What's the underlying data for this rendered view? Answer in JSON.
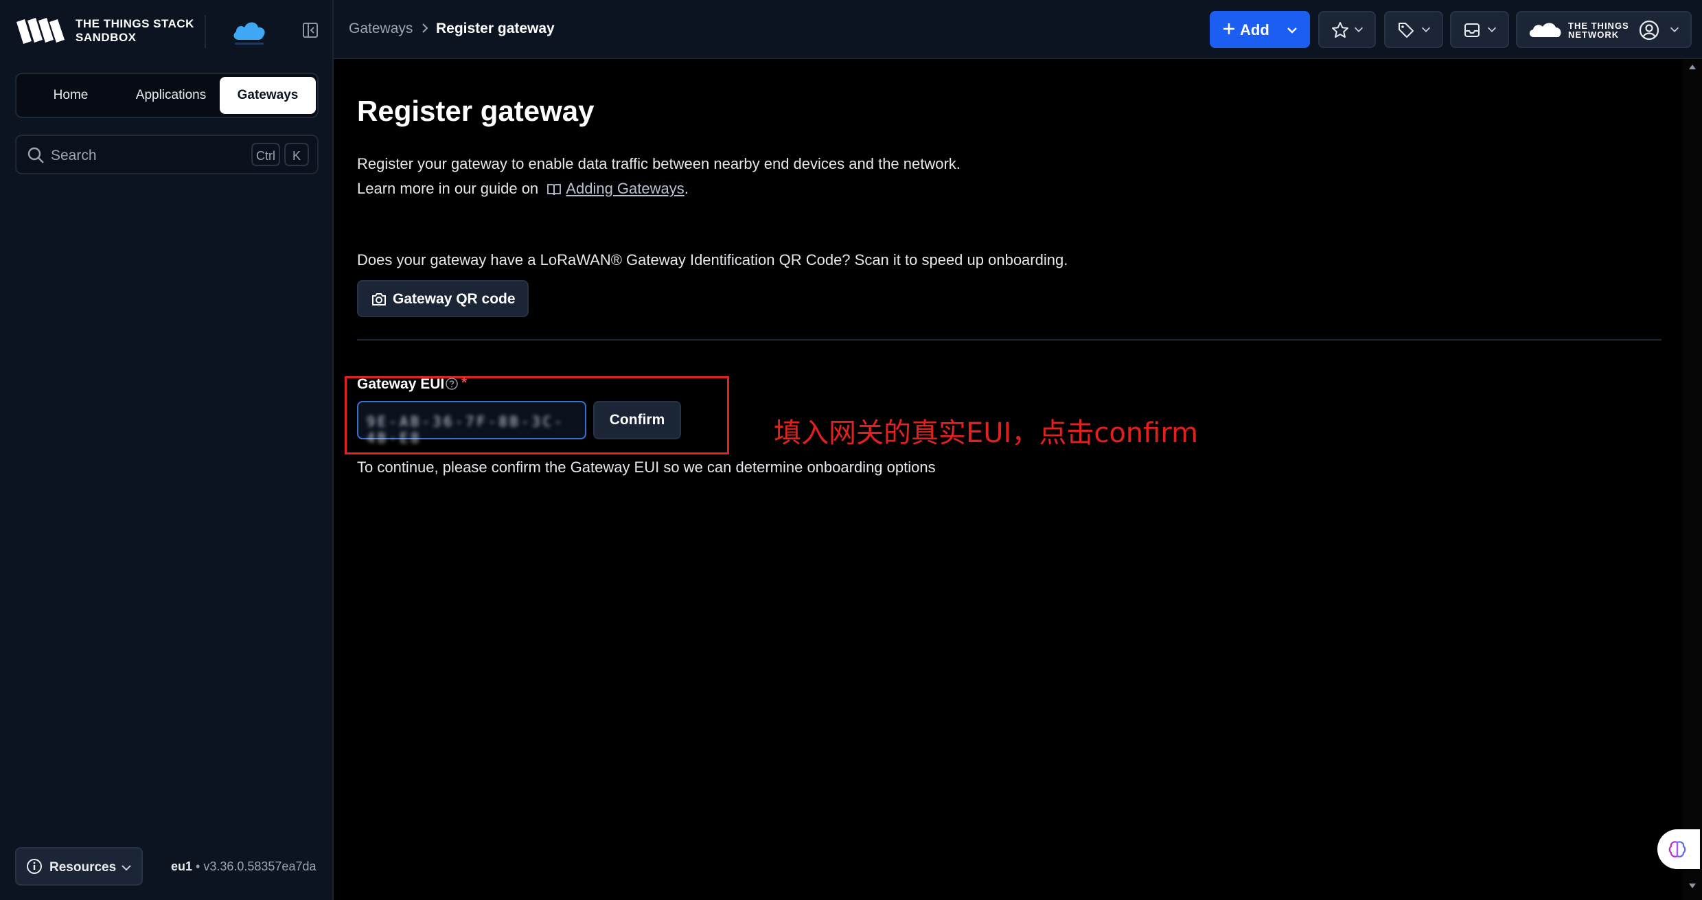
{
  "app": {
    "logo_line1": "THE THINGS STACK",
    "logo_line2": "SANDBOX",
    "collapse_icon": "sidebar-collapse-icon"
  },
  "sidebar": {
    "tabs": [
      {
        "label": "Home"
      },
      {
        "label": "Applications"
      },
      {
        "label": "Gateways"
      }
    ],
    "search": {
      "placeholder": "Search",
      "shortcut_mod": "Ctrl",
      "shortcut_key": "K"
    },
    "resources_label": "Resources",
    "cluster": "eu1",
    "version": " • v3.36.0.58357ea7da"
  },
  "header": {
    "breadcrumbs": [
      {
        "label": "Gateways"
      },
      {
        "label": "Register gateway"
      }
    ],
    "add_label": "Add",
    "network_logo_line1": "THE THINGS",
    "network_logo_line2": "NETWORK"
  },
  "main": {
    "title": "Register gateway",
    "description": "Register your gateway to enable data traffic between nearby end devices and the network.",
    "guide_prefix": "Learn more in our guide on",
    "guide_link": "Adding Gateways",
    "guide_suffix": ".",
    "qr_question": "Does your gateway have a LoRaWAN® Gateway Identification QR Code? Scan it to speed up onboarding.",
    "qr_button": "Gateway QR code",
    "eui_label": "Gateway EUI",
    "eui_required": "*",
    "eui_value": "9E-AB-36-7F-8B-3C-4B-E8",
    "confirm_label": "Confirm",
    "hint": "To continue, please confirm the Gateway EUI so we can determine onboarding options"
  },
  "annotation": {
    "text": "填入网关的真实EUI，点击confirm",
    "color": "#e0211d"
  },
  "colors": {
    "accent": "#1c5df2",
    "sidebar_bg": "#0c1421",
    "required": "#e5484d"
  }
}
